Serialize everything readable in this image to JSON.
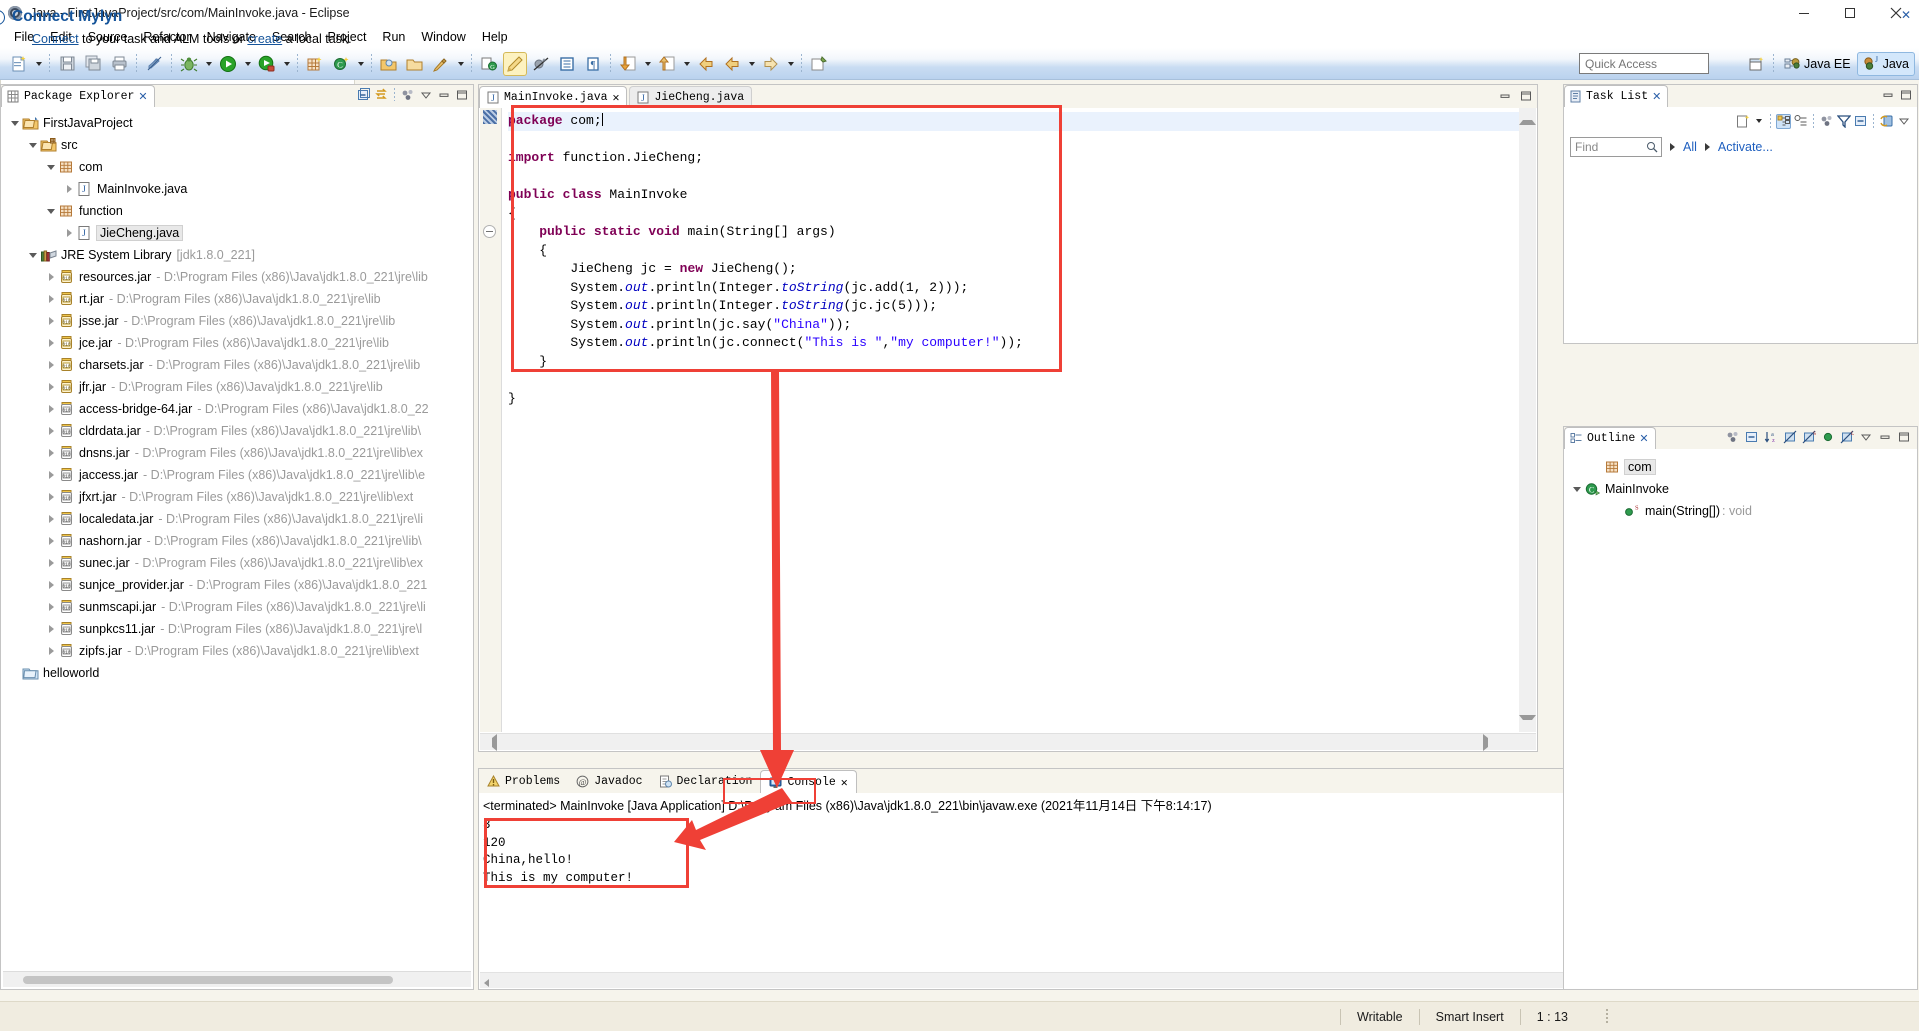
{
  "window": {
    "title": "Java - FirstJavaProject/src/com/MainInvoke.java - Eclipse",
    "app_icon": "eclipse-icon",
    "minimize": "minimize-icon",
    "maximize": "maximize-icon",
    "close": "close-icon"
  },
  "menubar": {
    "items": [
      "File",
      "Edit",
      "Source",
      "Refactor",
      "Navigate",
      "Search",
      "Project",
      "Run",
      "Window",
      "Help"
    ]
  },
  "toolbar": {
    "quick_access_placeholder": "Quick Access",
    "open_perspective_icon": "open-perspective-icon",
    "perspectives": [
      {
        "label": "Java EE",
        "icon": "java-ee-perspective-icon",
        "selected": false
      },
      {
        "label": "Java",
        "icon": "java-perspective-icon",
        "selected": true
      }
    ],
    "buttons": [
      "new-wizard-icon",
      "new-dropdown-arrow",
      "save-icon",
      "save-all-icon",
      "print-icon",
      "toggle-mark-occurrences-icon",
      "debug-icon",
      "debug-dropdown-arrow",
      "run-icon",
      "run-dropdown-arrow",
      "run-coverage-icon",
      "coverage-dropdown-arrow",
      "new-java-package-icon",
      "new-java-class-icon",
      "new-class-dropdown-arrow",
      "open-type-icon",
      "open-task-icon",
      "search-icon",
      "search-dropdown-arrow",
      "toggle-java-editor-breadcrumb-icon",
      "toggle-mark-occurrences-pen-icon",
      "skip-all-breakpoints-icon",
      "show-whitespace-icon",
      "block-selection-icon",
      "next-annotation-icon",
      "next-annotation-arrow",
      "previous-annotation-icon",
      "previous-annotation-arrow",
      "back-icon",
      "forward-icon",
      "forward-arrow",
      "pin-editor-icon"
    ]
  },
  "package_explorer": {
    "tab_label": "Package Explorer",
    "tab_icon": "package-explorer-icon",
    "tools": [
      "collapse-all-icon",
      "link-with-editor-icon",
      "view-menu-icon",
      "minimize-icon",
      "maximize-icon"
    ],
    "tree": [
      {
        "indent": 0,
        "twist": "open",
        "icon": "project-folder-icon",
        "label": "FirstJavaProject",
        "path": ""
      },
      {
        "indent": 1,
        "twist": "open",
        "icon": "source-folder-icon",
        "label": "src",
        "path": ""
      },
      {
        "indent": 2,
        "twist": "open",
        "icon": "package-icon",
        "label": "com",
        "path": ""
      },
      {
        "indent": 3,
        "twist": "closed",
        "icon": "java-file-icon",
        "label": "MainInvoke.java",
        "path": ""
      },
      {
        "indent": 2,
        "twist": "open",
        "icon": "package-icon",
        "label": "function",
        "path": ""
      },
      {
        "indent": 3,
        "twist": "closed",
        "icon": "java-file-icon",
        "label": "JieCheng.java",
        "path": "",
        "selected": true
      },
      {
        "indent": 1,
        "twist": "open",
        "icon": "jre-library-icon",
        "label": "JRE System Library",
        "path": "[jdk1.8.0_221]"
      },
      {
        "indent": 2,
        "twist": "closed",
        "icon": "jar-icon",
        "label": "resources.jar",
        "path": "- D:\\Program Files (x86)\\Java\\jdk1.8.0_221\\jre\\lib"
      },
      {
        "indent": 2,
        "twist": "closed",
        "icon": "jar-icon",
        "label": "rt.jar",
        "path": "- D:\\Program Files (x86)\\Java\\jdk1.8.0_221\\jre\\lib"
      },
      {
        "indent": 2,
        "twist": "closed",
        "icon": "jar-icon",
        "label": "jsse.jar",
        "path": "- D:\\Program Files (x86)\\Java\\jdk1.8.0_221\\jre\\lib"
      },
      {
        "indent": 2,
        "twist": "closed",
        "icon": "jar-icon",
        "label": "jce.jar",
        "path": "- D:\\Program Files (x86)\\Java\\jdk1.8.0_221\\jre\\lib"
      },
      {
        "indent": 2,
        "twist": "closed",
        "icon": "jar-icon",
        "label": "charsets.jar",
        "path": "- D:\\Program Files (x86)\\Java\\jdk1.8.0_221\\jre\\lib"
      },
      {
        "indent": 2,
        "twist": "closed",
        "icon": "jar-icon",
        "label": "jfr.jar",
        "path": "- D:\\Program Files (x86)\\Java\\jdk1.8.0_221\\jre\\lib"
      },
      {
        "indent": 2,
        "twist": "closed",
        "icon": "jar-ext-icon",
        "label": "access-bridge-64.jar",
        "path": "- D:\\Program Files (x86)\\Java\\jdk1.8.0_22"
      },
      {
        "indent": 2,
        "twist": "closed",
        "icon": "jar-ext-icon",
        "label": "cldrdata.jar",
        "path": "- D:\\Program Files (x86)\\Java\\jdk1.8.0_221\\jre\\lib\\"
      },
      {
        "indent": 2,
        "twist": "closed",
        "icon": "jar-ext-icon",
        "label": "dnsns.jar",
        "path": "- D:\\Program Files (x86)\\Java\\jdk1.8.0_221\\jre\\lib\\ex"
      },
      {
        "indent": 2,
        "twist": "closed",
        "icon": "jar-ext-icon",
        "label": "jaccess.jar",
        "path": "- D:\\Program Files (x86)\\Java\\jdk1.8.0_221\\jre\\lib\\e"
      },
      {
        "indent": 2,
        "twist": "closed",
        "icon": "jar-ext-icon",
        "label": "jfxrt.jar",
        "path": "- D:\\Program Files (x86)\\Java\\jdk1.8.0_221\\jre\\lib\\ext"
      },
      {
        "indent": 2,
        "twist": "closed",
        "icon": "jar-ext-icon",
        "label": "localedata.jar",
        "path": "- D:\\Program Files (x86)\\Java\\jdk1.8.0_221\\jre\\li"
      },
      {
        "indent": 2,
        "twist": "closed",
        "icon": "jar-ext-icon",
        "label": "nashorn.jar",
        "path": "- D:\\Program Files (x86)\\Java\\jdk1.8.0_221\\jre\\lib\\"
      },
      {
        "indent": 2,
        "twist": "closed",
        "icon": "jar-ext-icon",
        "label": "sunec.jar",
        "path": "- D:\\Program Files (x86)\\Java\\jdk1.8.0_221\\jre\\lib\\ex"
      },
      {
        "indent": 2,
        "twist": "closed",
        "icon": "jar-ext-icon",
        "label": "sunjce_provider.jar",
        "path": "- D:\\Program Files (x86)\\Java\\jdk1.8.0_221"
      },
      {
        "indent": 2,
        "twist": "closed",
        "icon": "jar-ext-icon",
        "label": "sunmscapi.jar",
        "path": "- D:\\Program Files (x86)\\Java\\jdk1.8.0_221\\jre\\li"
      },
      {
        "indent": 2,
        "twist": "closed",
        "icon": "jar-ext-icon",
        "label": "sunpkcs11.jar",
        "path": "- D:\\Program Files (x86)\\Java\\jdk1.8.0_221\\jre\\l"
      },
      {
        "indent": 2,
        "twist": "closed",
        "icon": "jar-ext-icon",
        "label": "zipfs.jar",
        "path": "- D:\\Program Files (x86)\\Java\\jdk1.8.0_221\\jre\\lib\\ext"
      },
      {
        "indent": 0,
        "twist": "none",
        "icon": "plain-folder-icon",
        "label": "helloworld",
        "path": ""
      }
    ]
  },
  "editor": {
    "tabs": [
      {
        "label": "MainInvoke.java",
        "icon": "java-file-icon",
        "active": true,
        "close": "close-icon"
      },
      {
        "label": "JieCheng.java",
        "icon": "java-file-icon",
        "active": false
      }
    ],
    "minimize": "minimize-icon",
    "maximize": "maximize-icon",
    "code_lines": [
      {
        "cursor": true,
        "tokens": [
          {
            "t": "package ",
            "c": "kw"
          },
          {
            "t": "com;",
            "c": ""
          },
          {
            "t": "|",
            "c": "caret"
          }
        ]
      },
      {
        "tokens": []
      },
      {
        "tokens": [
          {
            "t": "import ",
            "c": "kw"
          },
          {
            "t": "function.JieCheng;",
            "c": ""
          }
        ]
      },
      {
        "tokens": []
      },
      {
        "tokens": [
          {
            "t": "public class ",
            "c": "kw"
          },
          {
            "t": "MainInvoke",
            "c": ""
          }
        ]
      },
      {
        "tokens": [
          {
            "t": "{",
            "c": ""
          }
        ]
      },
      {
        "fold": true,
        "tokens": [
          {
            "t": "    public static void ",
            "c": "kw"
          },
          {
            "t": "main(String[] args)",
            "c": ""
          }
        ]
      },
      {
        "tokens": [
          {
            "t": "    {",
            "c": ""
          }
        ]
      },
      {
        "tokens": [
          {
            "t": "        JieCheng jc = ",
            "c": ""
          },
          {
            "t": "new ",
            "c": "kw"
          },
          {
            "t": "JieCheng();",
            "c": ""
          }
        ]
      },
      {
        "tokens": [
          {
            "t": "        System.",
            "c": ""
          },
          {
            "t": "out",
            "c": "ital"
          },
          {
            "t": ".println(Integer.",
            "c": ""
          },
          {
            "t": "toString",
            "c": "ital"
          },
          {
            "t": "(jc.add(1, 2)));",
            "c": ""
          }
        ]
      },
      {
        "tokens": [
          {
            "t": "        System.",
            "c": ""
          },
          {
            "t": "out",
            "c": "ital"
          },
          {
            "t": ".println(Integer.",
            "c": ""
          },
          {
            "t": "toString",
            "c": "ital"
          },
          {
            "t": "(jc.jc(5)));",
            "c": ""
          }
        ]
      },
      {
        "tokens": [
          {
            "t": "        System.",
            "c": ""
          },
          {
            "t": "out",
            "c": "ital"
          },
          {
            "t": ".println(jc.say(",
            "c": ""
          },
          {
            "t": "\"China\"",
            "c": "str"
          },
          {
            "t": "));",
            "c": ""
          }
        ]
      },
      {
        "tokens": [
          {
            "t": "        System.",
            "c": ""
          },
          {
            "t": "out",
            "c": "ital"
          },
          {
            "t": ".println(jc.connect(",
            "c": ""
          },
          {
            "t": "\"This is \"",
            "c": "str"
          },
          {
            "t": ",",
            "c": ""
          },
          {
            "t": "\"my computer!\"",
            "c": "str"
          },
          {
            "t": "));",
            "c": ""
          }
        ]
      },
      {
        "tokens": [
          {
            "t": "    }",
            "c": ""
          }
        ]
      },
      {
        "tokens": []
      },
      {
        "tokens": [
          {
            "t": "}",
            "c": ""
          }
        ]
      }
    ]
  },
  "console": {
    "tabs": [
      {
        "label": "Problems",
        "icon": "problems-icon",
        "active": false
      },
      {
        "label": "Javadoc",
        "icon": "javadoc-icon",
        "active": false
      },
      {
        "label": "Declaration",
        "icon": "declaration-icon",
        "active": false
      },
      {
        "label": "Console",
        "icon": "console-icon",
        "active": true,
        "close": "close-icon"
      }
    ],
    "tools": [
      "terminate-icon",
      "remove-launch-icon",
      "remove-all-terminated-icon",
      "clear-console-icon",
      "lock-scroll-icon",
      "show-console-on-output-icon",
      "show-console-on-error-icon",
      "pin-console-icon",
      "display-selected-console-icon",
      "display-selected-dropdown-arrow",
      "open-console-icon",
      "open-console-dropdown-arrow",
      "minimize-icon",
      "maximize-icon"
    ],
    "launch_line": "<terminated> MainInvoke [Java Application] D:\\Program Files (x86)\\Java\\jdk1.8.0_221\\bin\\javaw.exe (2021年11月14日 下午8:14:17)",
    "output": [
      "3",
      "120",
      "China,hello!",
      "This is my computer!"
    ]
  },
  "task_list": {
    "tab_label": "Task List",
    "tab_icon": "task-list-icon",
    "minimize": "minimize-icon",
    "maximize": "maximize-icon",
    "tools": [
      "new-task-icon",
      "new-task-dropdown-arrow",
      "categorized-presentation-icon",
      "scheduled-presentation-icon",
      "focus-on-workweek-icon",
      "filter-icon",
      "collapse-all-icon",
      "synchronize-changed-icon",
      "view-menu-icon"
    ],
    "find_placeholder": "Find",
    "search_icon": "search-icon",
    "links": [
      "All",
      "Activate..."
    ]
  },
  "mylyn": {
    "title": "Connect Mylyn",
    "info_icon": "info-icon",
    "close_icon": "close-icon",
    "text_before": "Connect",
    "text_middle": " to your task and ALM tools or ",
    "link2": "create",
    "text_after": " a local task."
  },
  "outline": {
    "tab_label": "Outline",
    "tab_icon": "outline-icon",
    "tools": [
      "focus-on-active-task-icon",
      "collapse-all-icon",
      "sort-icon",
      "hide-fields-icon",
      "hide-static-icon",
      "hide-non-public-icon",
      "hide-local-types-icon",
      "view-menu-icon",
      "minimize-icon",
      "maximize-icon"
    ],
    "tree": [
      {
        "indent": 1,
        "twist": "none",
        "icon": "package-icon",
        "label": "com",
        "selected": true
      },
      {
        "indent": 0,
        "twist": "open",
        "icon": "class-public-icon",
        "label": "MainInvoke"
      },
      {
        "indent": 2,
        "twist": "none",
        "icon": "method-public-static-icon",
        "label": "main(String[])",
        "type": " : void"
      }
    ]
  },
  "status_bar": {
    "writable": "Writable",
    "insert_mode": "Smart Insert",
    "position": "1 : 13"
  },
  "annotations": {
    "color": "#ef4036",
    "boxes": [
      "code-block-highlight",
      "console-output-highlight",
      "console-tab-highlight"
    ],
    "arrows": [
      "arrow-code-to-console-tab",
      "arrow-launch-to-output"
    ]
  }
}
